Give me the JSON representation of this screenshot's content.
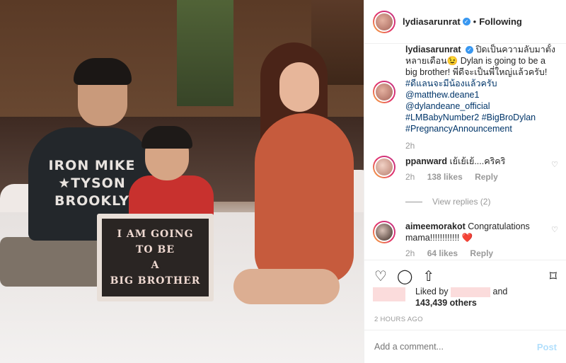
{
  "photo": {
    "shirt_text": [
      "IRON MIKE",
      "★TYSON",
      "BROOKLY"
    ],
    "letterboard": [
      "I AM GOING",
      "TO BE",
      "A",
      "BIG BROTHER"
    ]
  },
  "header": {
    "username": "lydiasarunrat",
    "verified_icon": "✓",
    "separator": "•",
    "follow_status": "Following"
  },
  "caption": {
    "username": "lydiasarunrat",
    "text_1": "ปิดเป็นความลับมาตั้งหลายเดือน😉 Dylan is going to be a big brother! พี่ดีจะเป็นพี่ใหญ่แล้วครับ! ",
    "tag_1": "#ดีแลนจะมีน้องแล้วครับ",
    "mention_1": "@matthew.deane1",
    "mention_2": "@dylandeane_official",
    "tag_2": "#LMBabyNumber2",
    "tag_3": "#BigBroDylan",
    "tag_4": "#PregnancyAnnouncement",
    "time": "2h"
  },
  "comments": [
    {
      "username": "ppanward",
      "text": "เย้เย้เย้....คริคริ",
      "time": "2h",
      "likes": "138 likes",
      "reply": "Reply",
      "heart_icon": "♡"
    },
    {
      "username": "aimeemorakot",
      "text": "Congratulations mama!!!!!!!!!!!! ❤️",
      "time": "2h",
      "likes": "64 likes",
      "reply": "Reply",
      "heart_icon": "♡"
    }
  ],
  "view_replies": "View replies (2)",
  "actions": {
    "like_icon": "♡",
    "comment_icon": "◯",
    "share_icon": "⇧",
    "bookmark_icon": "⌑"
  },
  "likes_summary": {
    "prefix": "Liked by",
    "and": "and",
    "count": "143,439 others"
  },
  "timestamp": "2 HOURS AGO",
  "add_comment": {
    "placeholder": "Add a comment...",
    "post_label": "Post"
  },
  "colors": {
    "accent": "#3897f0",
    "tag": "#003569",
    "muted": "#999999",
    "post_disabled": "#b2dffc"
  }
}
